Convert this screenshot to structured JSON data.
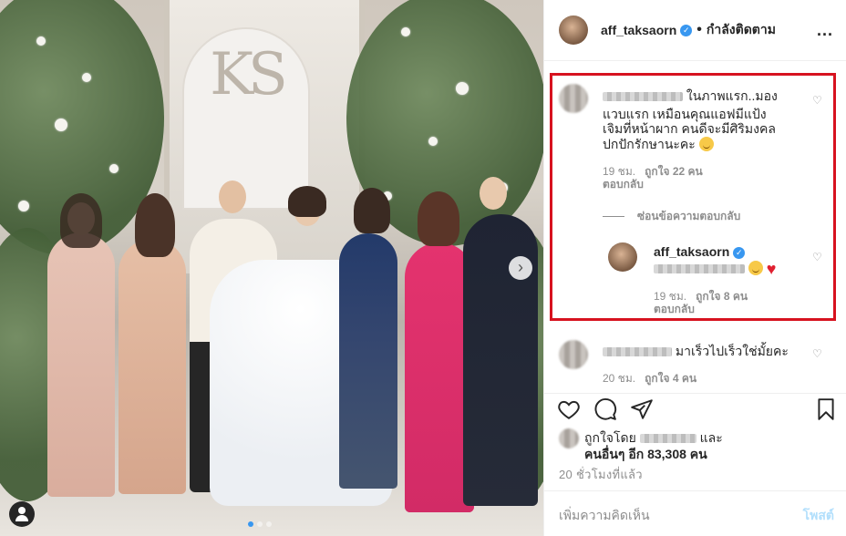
{
  "post": {
    "monogram": "KS",
    "slide_count": 6,
    "active_slide": 1
  },
  "header": {
    "username": "aff_taksaorn",
    "verified_icon": "verified-badge-icon",
    "bullet": "•",
    "follow_status": "กำลังติดตาม",
    "more": "..."
  },
  "comments": [
    {
      "text_1": "ในภาพแรก..มอง",
      "text_2": "แวบแรก เหมือนคุณแอฟมีแป้ง",
      "text_3": "เจิมที่หน้าผาก คนดีจะมีศิริมงคล",
      "text_4": "ปกปักรักษานะคะ",
      "time": "19 ชม.",
      "likes": "ถูกใจ 22 คน",
      "reply": "ตอบกลับ"
    }
  ],
  "thread": {
    "hide_replies": "ซ่อนข้อความตอบกลับ"
  },
  "reply": {
    "username": "aff_taksaorn",
    "time": "19 ชม.",
    "likes": "ถูกใจ 8 คน",
    "reply": "ตอบกลับ"
  },
  "comment2": {
    "text": "มาเร็วไปเร็วใช่มั้ยคะ",
    "time": "20 ชม.",
    "likes": "ถูกใจ 4 คน"
  },
  "likes": {
    "prefix": "ถูกใจโดย",
    "and": "และ",
    "others": "คนอื่นๆ อีก 83,308 คน"
  },
  "timestamp": "20 ชั่วโมงที่แล้ว",
  "add_comment": {
    "placeholder": "เพิ่มความคิดเห็น",
    "post": "โพสต์"
  },
  "colors": {
    "highlight": "#d7121f",
    "link": "#3897f0",
    "muted": "#8e8e8e"
  }
}
